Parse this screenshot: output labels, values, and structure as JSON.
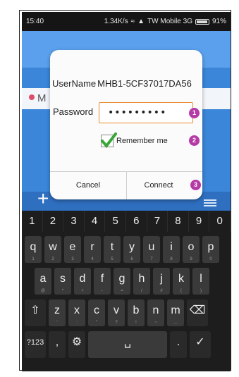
{
  "status": {
    "time": "15:40",
    "speed": "1.34K/s",
    "carrier": "TW Mobile 3G",
    "battery": "91%",
    "battery_level": 0.91
  },
  "background": {
    "peek_text": "M"
  },
  "dialog": {
    "username_label": "UserName",
    "username_value": "MHB1-5CF37017DA56",
    "password_label": "Password",
    "password_value": "•••••••••",
    "remember_label": "Remember me",
    "cancel_label": "Cancel",
    "connect_label": "Connect",
    "badges": [
      "1",
      "2",
      "3"
    ]
  },
  "keyboard": {
    "numbers": [
      "1",
      "2",
      "3",
      "4",
      "5",
      "6",
      "7",
      "8",
      "9",
      "0"
    ],
    "row1": [
      [
        "q",
        "1"
      ],
      [
        "w",
        "2"
      ],
      [
        "e",
        "3"
      ],
      [
        "r",
        "4"
      ],
      [
        "t",
        "5"
      ],
      [
        "y",
        "6"
      ],
      [
        "u",
        "7"
      ],
      [
        "i",
        "8"
      ],
      [
        "o",
        "9"
      ],
      [
        "p",
        "0"
      ]
    ],
    "row2": [
      [
        "a",
        "@"
      ],
      [
        "s",
        "*"
      ],
      [
        "d",
        "+"
      ],
      [
        "f",
        "-"
      ],
      [
        "g",
        "="
      ],
      [
        "h",
        "/"
      ],
      [
        "j",
        "#"
      ],
      [
        "k",
        "("
      ],
      [
        "l",
        ")"
      ]
    ],
    "row3": [
      [
        "z",
        "'"
      ],
      [
        "x",
        ":"
      ],
      [
        "c",
        "\""
      ],
      [
        "v",
        "?"
      ],
      [
        "b",
        "!"
      ],
      [
        "n",
        "~"
      ],
      [
        "m",
        "…"
      ]
    ],
    "mode_key": "?123",
    "comma_key": ",",
    "period_key": "."
  },
  "colors": {
    "accent": "#e68a2e",
    "badge": "#b53aa6",
    "app_blue": "#3b86d8"
  }
}
